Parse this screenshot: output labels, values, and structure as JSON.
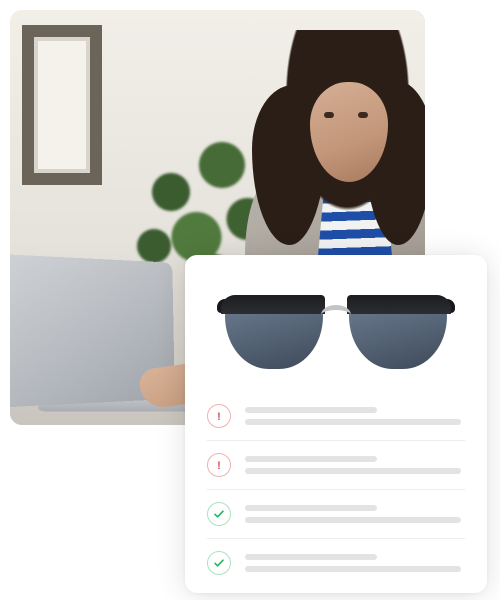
{
  "photo": {
    "alt": "Woman with dark hair in a grey blazer typing on a laptop, plant in background"
  },
  "card": {
    "product_image_alt": "Black browline sunglasses with dark blue lenses",
    "rows": [
      {
        "status": "error",
        "icon": "alert-icon"
      },
      {
        "status": "error",
        "icon": "alert-icon"
      },
      {
        "status": "success",
        "icon": "check-icon"
      },
      {
        "status": "success",
        "icon": "check-icon"
      }
    ]
  },
  "colors": {
    "error": "#d85151",
    "success": "#1fb65c"
  }
}
